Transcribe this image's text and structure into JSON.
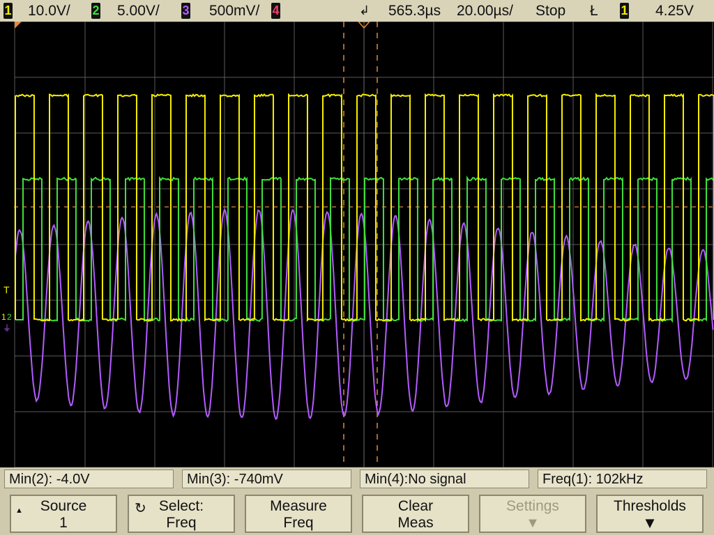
{
  "status": {
    "ch1": {
      "num": "1",
      "scale": "10.0V/"
    },
    "ch2": {
      "num": "2",
      "scale": "5.00V/"
    },
    "ch3": {
      "num": "3",
      "scale": "500mV/"
    },
    "ch4": {
      "num": "4"
    },
    "delay": "565.3µs",
    "timebase": "20.00µs/",
    "run_state": "Stop",
    "trigger_source": "1",
    "trigger_level": "4.25V"
  },
  "markers": {
    "trigger": "T",
    "ch1_ref": "1",
    "ch2_ref": "2"
  },
  "measurements": [
    {
      "label": "Min(2): -4.0V"
    },
    {
      "label": "Min(3): -740mV"
    },
    {
      "label": "Min(4):No signal"
    },
    {
      "label": "Freq(1): 102kHz"
    }
  ],
  "softkeys": [
    {
      "line1": "Source",
      "line2": "1"
    },
    {
      "line1": "Select:",
      "line2": "Freq"
    },
    {
      "line1": "Measure",
      "line2": "Freq"
    },
    {
      "line1": "Clear",
      "line2": "Meas"
    },
    {
      "line1": "Settings",
      "line2": ""
    },
    {
      "line1": "Thresholds",
      "line2": ""
    }
  ],
  "colors": {
    "ch1": "#f6f000",
    "ch2": "#3fe03a",
    "ch3": "#b35cff",
    "ch4": "#ff3b6b",
    "grid": "#6e6e6e",
    "cursor": "#e08a3c"
  },
  "trace_model": {
    "ch1_period_us": 9.8,
    "ch1_duty": 0.55,
    "ch2_duty": 0.55,
    "ch3_period_us": 9.8
  }
}
